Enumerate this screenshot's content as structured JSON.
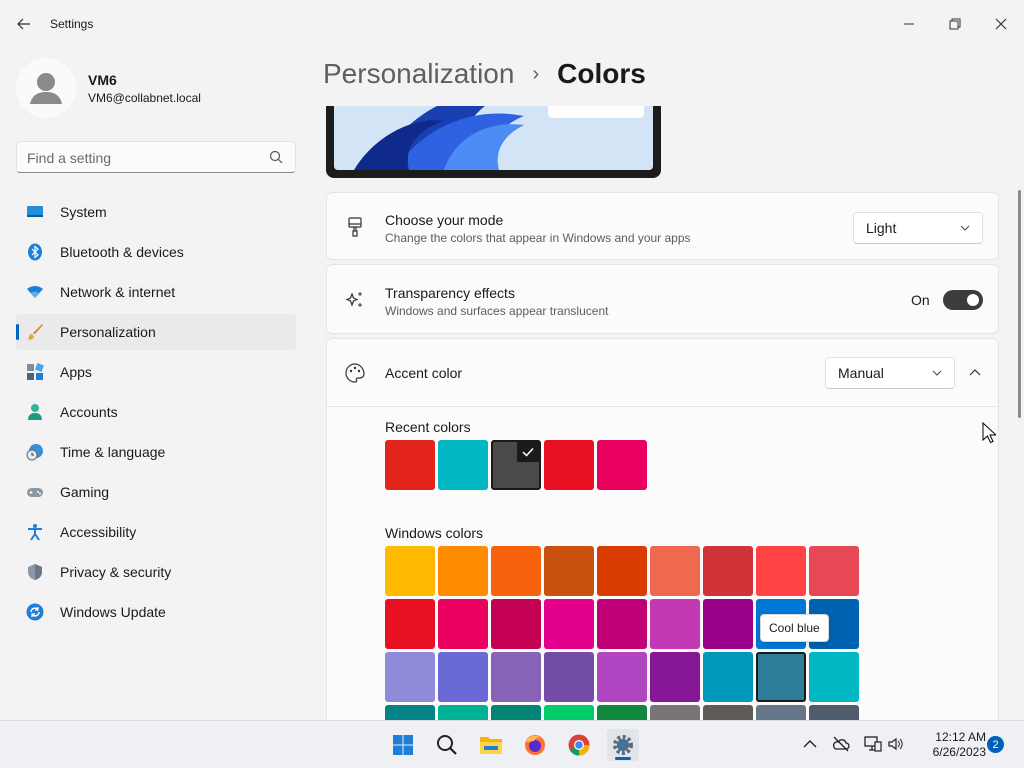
{
  "window": {
    "title": "Settings"
  },
  "user": {
    "name": "VM6",
    "email": "VM6@collabnet.local"
  },
  "search": {
    "placeholder": "Find a setting"
  },
  "sidebar": {
    "items": [
      {
        "label": "System",
        "icon": "system-icon"
      },
      {
        "label": "Bluetooth & devices",
        "icon": "bluetooth-icon"
      },
      {
        "label": "Network & internet",
        "icon": "wifi-icon"
      },
      {
        "label": "Personalization",
        "icon": "brush-icon",
        "active": true
      },
      {
        "label": "Apps",
        "icon": "apps-icon"
      },
      {
        "label": "Accounts",
        "icon": "accounts-icon"
      },
      {
        "label": "Time & language",
        "icon": "globe-clock-icon"
      },
      {
        "label": "Gaming",
        "icon": "gamepad-icon"
      },
      {
        "label": "Accessibility",
        "icon": "accessibility-icon"
      },
      {
        "label": "Privacy & security",
        "icon": "shield-icon"
      },
      {
        "label": "Windows Update",
        "icon": "update-icon"
      }
    ]
  },
  "breadcrumb": {
    "parent": "Personalization",
    "separator": "›",
    "current": "Colors"
  },
  "mode": {
    "title": "Choose your mode",
    "description": "Change the colors that appear in Windows and your apps",
    "value": "Light"
  },
  "transparency": {
    "title": "Transparency effects",
    "description": "Windows and surfaces appear translucent",
    "state_label": "On",
    "enabled": true
  },
  "accent": {
    "title": "Accent color",
    "value": "Manual",
    "recent_label": "Recent colors",
    "recent_colors": [
      "#e3241b",
      "#00b7c3",
      "#4c4a48",
      "#e81123",
      "#ea005e"
    ],
    "recent_selected_index": 2,
    "windows_label": "Windows colors",
    "windows_colors": [
      [
        "#ffb900",
        "#ff8c00",
        "#f7630c",
        "#ca5010",
        "#da3b01",
        "#ef6950",
        "#d13438",
        "#ff4343",
        "#e74856"
      ],
      [
        "#e81123",
        "#ea005e",
        "#c30052",
        "#e3008c",
        "#bf0077",
        "#c239b3",
        "#9a0089",
        "#0078d7",
        "#0063b1"
      ],
      [
        "#8e8cd8",
        "#6b69d6",
        "#8764b8",
        "#744da9",
        "#b146c2",
        "#881798",
        "#0099bc",
        "#2d7d9a",
        "#00b7c3"
      ],
      [
        "#038387",
        "#00b294",
        "#018574",
        "#00cc6a",
        "#10893e",
        "#7a7574",
        "#5d5a58",
        "#68768a",
        "#515c6b"
      ]
    ],
    "hovered": {
      "row": 2,
      "col": 7
    },
    "tooltip": "Cool blue"
  },
  "taskbar": {
    "apps": [
      "windows-start-icon",
      "search-icon",
      "file-explorer-icon",
      "firefox-icon",
      "chrome-icon",
      "settings-icon"
    ],
    "time": "12:12 AM",
    "date": "6/26/2023",
    "notification_count": "2"
  },
  "colors": {
    "accent": "#0067c0",
    "toggle_on": "#3c3c3c"
  }
}
